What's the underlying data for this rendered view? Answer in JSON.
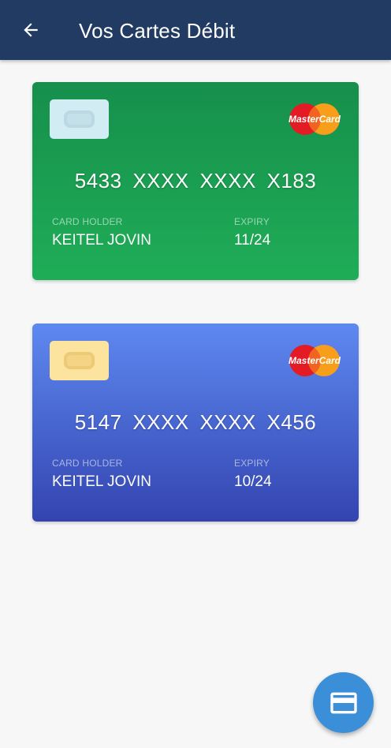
{
  "appbar": {
    "title": "Vos Cartes Débit",
    "back_icon": "arrow-left-icon",
    "background": "#213b63"
  },
  "cards": [
    {
      "theme": "green",
      "number": "5433 XXXX XXXX X183",
      "holder_label": "CARD HOLDER",
      "holder_name": "KEITEL JOVIN",
      "expiry_label": "EXPIRY",
      "expiry": "11/24",
      "brand": "MasterCard",
      "colors": [
        "#168f4c",
        "#1fad57"
      ]
    },
    {
      "theme": "blue",
      "number": "5147 XXXX XXXX X456",
      "holder_label": "CARD HOLDER",
      "holder_name": "KEITEL JOVIN",
      "expiry_label": "EXPIRY",
      "expiry": "10/24",
      "brand": "MasterCard",
      "colors": [
        "#5e89f0",
        "#3344b0"
      ]
    }
  ],
  "fab": {
    "icon": "credit-card-icon",
    "color": "#3b8fd8"
  }
}
